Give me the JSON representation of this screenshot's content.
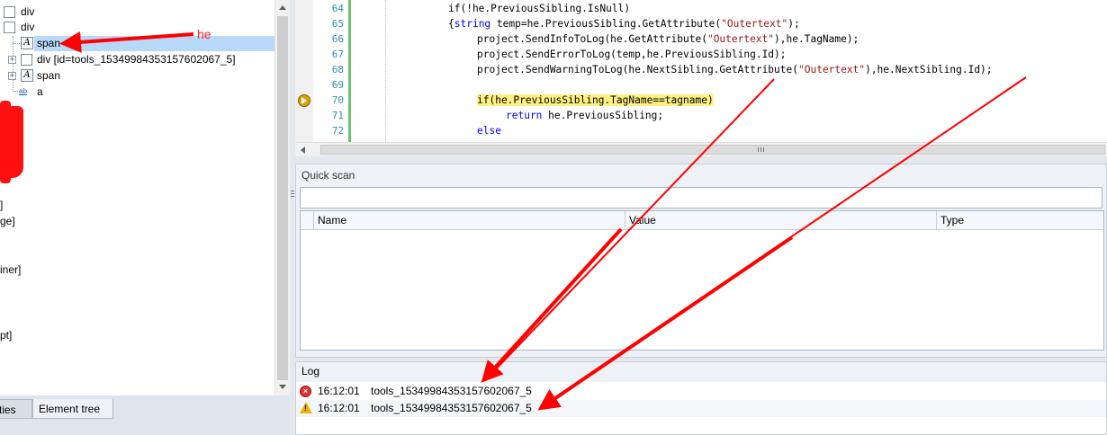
{
  "tree": {
    "rows": [
      {
        "label": "div"
      },
      {
        "label": "div"
      },
      {
        "label": "span",
        "icon": "A"
      },
      {
        "label": "div [id=tools_15349984353157602067_5]"
      },
      {
        "label": "span",
        "icon": "A"
      },
      {
        "label": "a",
        "icon": "ab"
      }
    ],
    "cutoff_labels": [
      "]",
      "ge]",
      "iner]",
      "pt]"
    ]
  },
  "annotation": {
    "label": "he",
    "color": "#ff0000"
  },
  "tabs": {
    "properties": "rties",
    "element_tree": "Element tree"
  },
  "editor": {
    "line_numbers": [
      "64",
      "65",
      "66",
      "67",
      "68",
      "69",
      "70",
      "71",
      "72"
    ],
    "lines": [
      [
        {
          "t": "if(!he.PreviousSibling.IsNull)"
        }
      ],
      [
        {
          "t": "{"
        },
        {
          "t": "string",
          "c": "kw"
        },
        {
          "t": " temp=he.PreviousSibling.GetAttribute("
        },
        {
          "t": "\"Outertext\"",
          "c": "str"
        },
        {
          "t": ");"
        }
      ],
      [
        {
          "t": "project.SendInfoToLog(he.GetAttribute("
        },
        {
          "t": "\"Outertext\"",
          "c": "str"
        },
        {
          "t": "),he.TagName);"
        }
      ],
      [
        {
          "t": "project.SendErrorToLog(temp,he.PreviousSibling.Id);"
        }
      ],
      [
        {
          "t": "project.SendWarningToLog(he.NextSibling.GetAttribute("
        },
        {
          "t": "\"Outertext\"",
          "c": "str"
        },
        {
          "t": "),he.NextSibling.Id);"
        }
      ],
      [
        {
          "t": ""
        }
      ],
      [
        {
          "t": "if(he.PreviousSibling.TagName==tagname)",
          "c": "hl"
        }
      ],
      [
        {
          "t": "return",
          "c": "kw"
        },
        {
          "t": " he.PreviousSibling;"
        }
      ],
      [
        {
          "t": "else",
          "c": "kw"
        }
      ]
    ]
  },
  "quick_scan": {
    "title": "Quick scan",
    "input_value": "",
    "columns": [
      "Name",
      "Value",
      "Type"
    ]
  },
  "log": {
    "title": "Log",
    "entries": [
      {
        "level": "error",
        "time": "16:12:01",
        "message": "tools_15349984353157602067_5"
      },
      {
        "level": "warning",
        "time": "16:12:01",
        "message": "tools_15349984353157602067_5"
      }
    ]
  },
  "colors": {
    "accent_selection": "#b8d8f8",
    "arrow": "#ff0000",
    "highlight": "#fff080",
    "keyword": "#0000ff",
    "string": "#a31515",
    "line_number": "#2b91af"
  }
}
